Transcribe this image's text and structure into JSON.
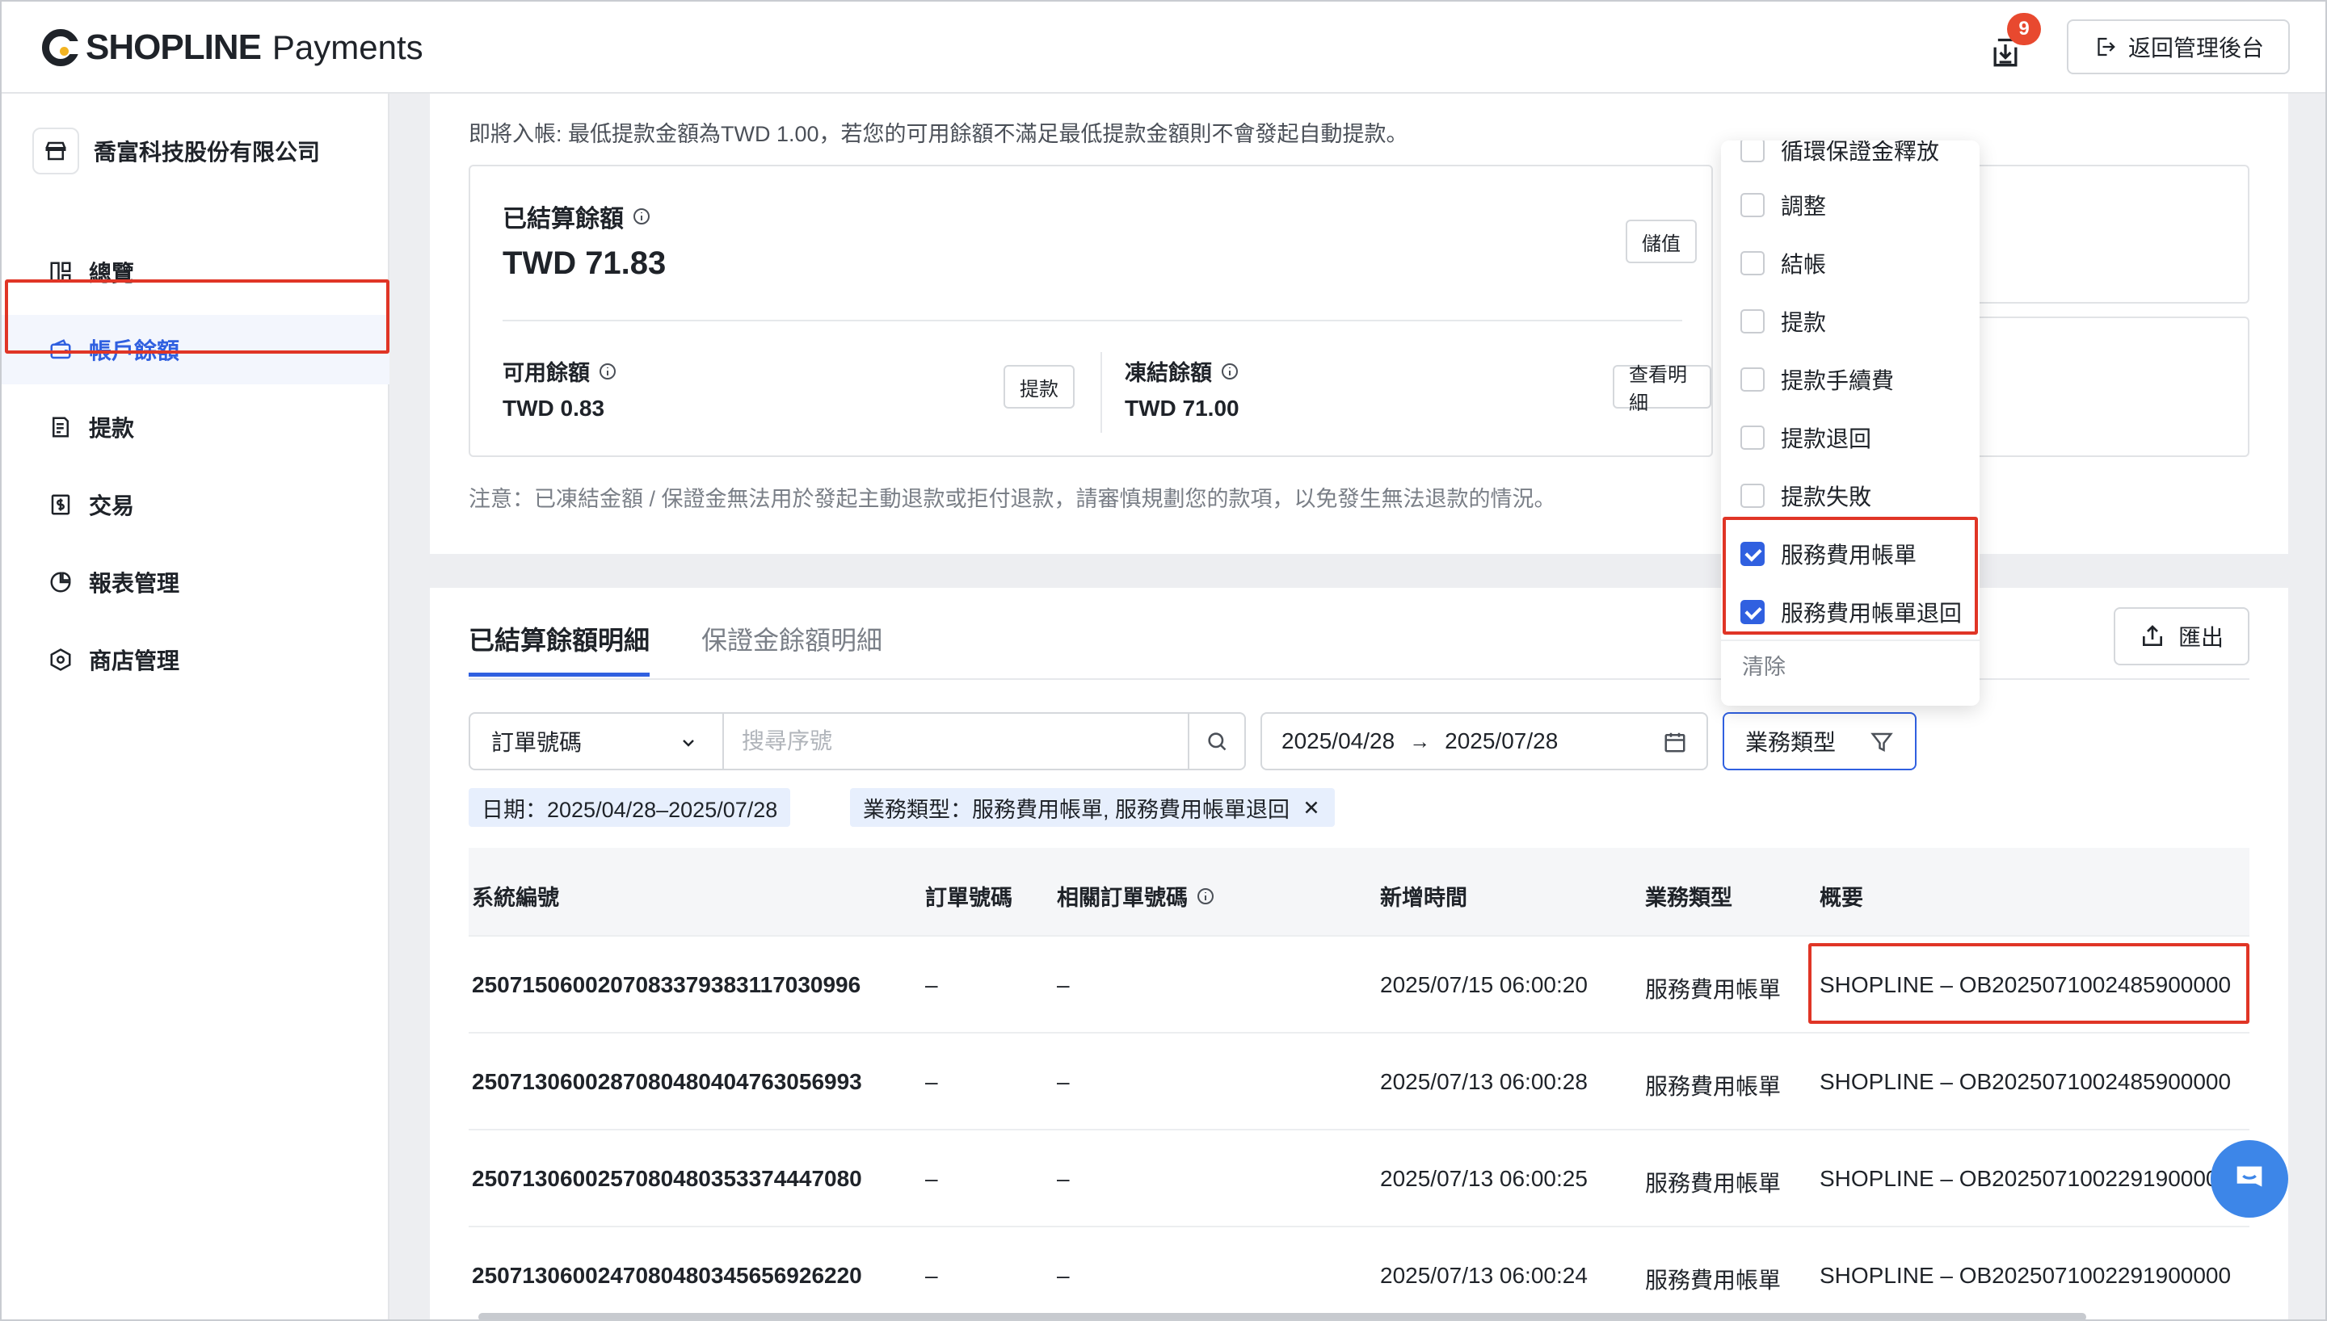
{
  "header": {
    "brand": "SHOPLINE",
    "brand_sub": "Payments",
    "download_badge": "9",
    "back_button": "返回管理後台"
  },
  "sidebar": {
    "company": "喬富科技股份有限公司",
    "items": [
      {
        "label": "總覽",
        "icon": "dashboard-icon"
      },
      {
        "label": "帳戶餘額",
        "icon": "wallet-icon"
      },
      {
        "label": "提款",
        "icon": "withdraw-icon"
      },
      {
        "label": "交易",
        "icon": "transaction-icon"
      },
      {
        "label": "報表管理",
        "icon": "report-icon"
      },
      {
        "label": "商店管理",
        "icon": "store-icon"
      }
    ],
    "active_index": 1
  },
  "balance": {
    "notice": "即將入帳: 最低提款金額為TWD 1.00，若您的可用餘額不滿足最低提款金額則不會發起自動提款。",
    "settled_title": "已結算餘額",
    "settled_amount": "TWD 71.83",
    "topup_button": "儲值",
    "available_label": "可用餘額",
    "available_amount": "TWD 0.83",
    "withdraw_button": "提款",
    "frozen_label": "凍結餘額",
    "frozen_amount": "TWD 71.00",
    "details_button": "查看明細",
    "caution": "注意：已凍結金額 / 保證金無法用於發起主動退款或拒付退款，請審慎規劃您的款項，以免發生無法退款的情況。"
  },
  "details": {
    "tabs": [
      "已結算餘額明細",
      "保證金餘額明細"
    ],
    "export_button": "匯出",
    "filter": {
      "select_value": "訂單號碼",
      "search_placeholder": "搜尋序號",
      "date_start": "2025/04/28",
      "date_arrow": "→",
      "date_end": "2025/07/28",
      "type_button": "業務類型"
    },
    "tags": [
      "日期：2025/04/28–2025/07/28",
      "業務類型：服務費用帳單, 服務費用帳單退回"
    ],
    "columns": [
      "系統編號",
      "訂單號碼",
      "相關訂單號碼",
      "新增時間",
      "業務類型",
      "概要"
    ],
    "rows": [
      [
        "25071506002070833793831170309​96",
        "–",
        "–",
        "2025/07/15 06:00:20",
        "服務費用帳單",
        "SHOPLINE – OB2025071002485900000"
      ],
      [
        "250713060028708048040476305699​3",
        "–",
        "–",
        "2025/07/13 06:00:28",
        "服務費用帳單",
        "SHOPLINE – OB2025071002485900000"
      ],
      [
        "250713060025708048035337444708​0",
        "–",
        "–",
        "2025/07/13 06:00:25",
        "服務費用帳單",
        "SHOPLINE – OB2025071002291900000"
      ],
      [
        "250713060024708048034565692622​0",
        "–",
        "–",
        "2025/07/13 06:00:24",
        "服務費用帳單",
        "SHOPLINE – OB2025071002291900000"
      ]
    ]
  },
  "dropdown": {
    "items": [
      {
        "label": "循環保證金釋放",
        "checked": false
      },
      {
        "label": "調整",
        "checked": false
      },
      {
        "label": "結帳",
        "checked": false
      },
      {
        "label": "提款",
        "checked": false
      },
      {
        "label": "提款手續費",
        "checked": false
      },
      {
        "label": "提款退回",
        "checked": false
      },
      {
        "label": "提款失敗",
        "checked": false
      },
      {
        "label": "服務費用帳單",
        "checked": true
      },
      {
        "label": "服務費用帳單退回",
        "checked": true
      }
    ],
    "clear": "清除"
  },
  "colors": {
    "accent": "#3060e0",
    "highlight": "#e03526",
    "chat": "#3d86e8"
  }
}
